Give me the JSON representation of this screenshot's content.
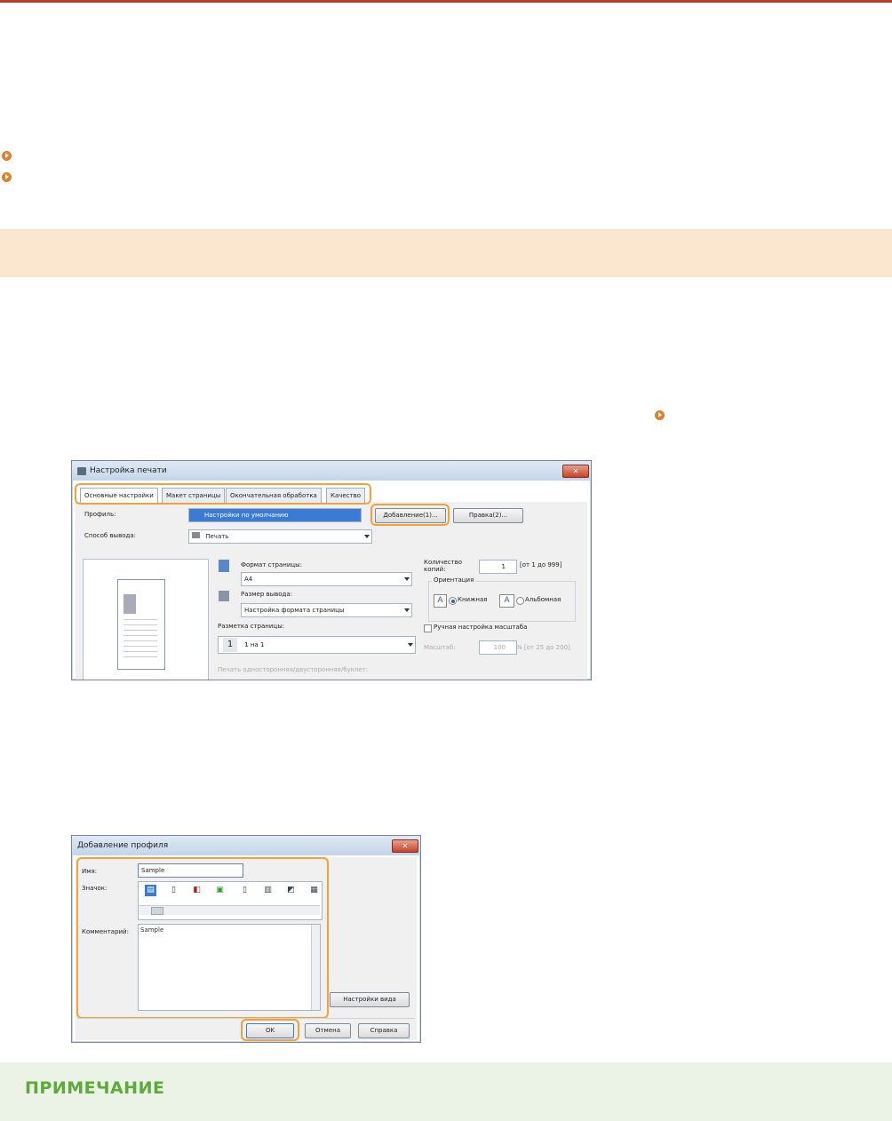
{
  "print_dialog": {
    "title": "Настройка печати",
    "close": "✕",
    "tabs": [
      "Основные настройки",
      "Макет страницы",
      "Окончательная обработка",
      "Качество"
    ],
    "profile_label": "Профиль:",
    "profile_value": "Настройки по умолчанию",
    "add_button": "Добавление(1)...",
    "edit_button": "Правка(2)...",
    "output_label": "Способ вывода:",
    "output_value": "Печать",
    "page_size_label": "Формат страницы:",
    "page_size_value": "A4",
    "output_size_label": "Размер вывода:",
    "output_size_value": "Настройка формата страницы",
    "layout_label": "Разметка страницы:",
    "layout_num": "1",
    "layout_value": "1 на 1",
    "duplex_label": "Печать односторонняя/двусторонняя/буклет:",
    "copies_label": "Количество копий:",
    "copies_value": "1",
    "copies_range": "[от 1 до 999]",
    "orientation_label": "Ориентация",
    "portrait_label": "Книжная",
    "landscape_label": "Альбомная",
    "manual_scale_label": "Ручная настройка масштаба",
    "scale_label": "Масштаб:",
    "scale_value": "100",
    "scale_range": "% [от 25 до 200]"
  },
  "profile_dialog": {
    "title": "Добавление профиля",
    "close": "✕",
    "name_label": "Имя:",
    "name_value": "Sample",
    "icon_label": "Значок:",
    "comment_label": "Комментарий:",
    "comment_value": "Sample",
    "view_settings_button": "Настройки вида",
    "ok_button": "OK",
    "cancel_button": "Отмена",
    "help_button": "Справка"
  },
  "note": {
    "title": "ПРИМЕЧАНИЕ"
  }
}
